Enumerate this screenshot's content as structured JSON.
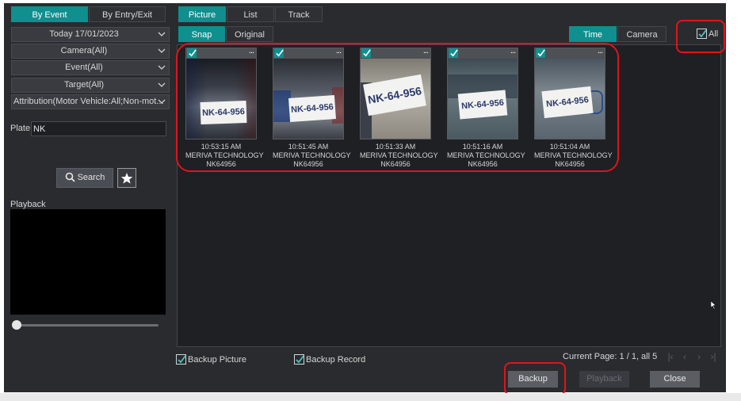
{
  "top_tabs": {
    "by_event": "By Event",
    "by_entry_exit": "By Entry/Exit"
  },
  "view_tabs": {
    "picture": "Picture",
    "list": "List",
    "track": "Track"
  },
  "image_tabs": {
    "snap": "Snap",
    "original": "Original"
  },
  "sort_tabs": {
    "time": "Time",
    "camera": "Camera"
  },
  "filters": {
    "date": "Today 17/01/2023",
    "camera": "Camera(All)",
    "event": "Event(All)",
    "target": "Target(All)",
    "attribution": "Attribution(Motor Vehicle:All;Non-mot..."
  },
  "plate": {
    "label": "Plate",
    "value": "NK"
  },
  "search": {
    "label": "Search"
  },
  "playback": {
    "label": "Playback",
    "progress": 0
  },
  "all_checkbox": {
    "label": "All",
    "checked": true
  },
  "results": [
    {
      "time": "10:53:15 AM",
      "camera": "MERIVA TECHNOLOGY",
      "plate": "NK64956",
      "plate_image_text": "NK-64-956",
      "checked": true
    },
    {
      "time": "10:51:45 AM",
      "camera": "MERIVA TECHNOLOGY",
      "plate": "NK64956",
      "plate_image_text": "NK-64-956",
      "checked": true
    },
    {
      "time": "10:51:33 AM",
      "camera": "MERIVA TECHNOLOGY",
      "plate": "NK64956",
      "plate_image_text": "NK-64-956",
      "checked": true
    },
    {
      "time": "10:51:16 AM",
      "camera": "MERIVA TECHNOLOGY",
      "plate": "NK64956",
      "plate_image_text": "NK-64-956",
      "checked": true
    },
    {
      "time": "10:51:04 AM",
      "camera": "MERIVA TECHNOLOGY",
      "plate": "NK64956",
      "plate_image_text": "NK-64-956",
      "checked": true
    }
  ],
  "more_glyph": "...",
  "backup_options": {
    "picture": "Backup Picture",
    "record": "Backup Record"
  },
  "pager": {
    "text": "Current Page: 1 / 1, all 5"
  },
  "buttons": {
    "backup": "Backup",
    "playback": "Playback",
    "close": "Close"
  },
  "colors": {
    "accent": "#0f8f8e",
    "highlight": "#e0141b",
    "background": "#2a2b2e"
  }
}
